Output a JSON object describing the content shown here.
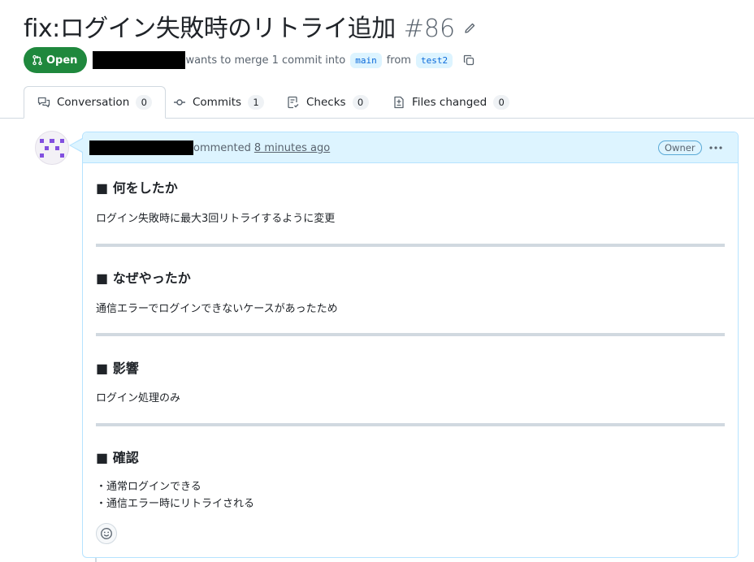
{
  "pr": {
    "title": "fix:ログイン失敗時のリトライ追加",
    "number": "#86",
    "state": "Open",
    "merge_text": "wants to merge 1 commit into",
    "base_branch": "main",
    "from_text": "from",
    "head_branch": "test2"
  },
  "tabs": [
    {
      "label": "Conversation",
      "count": "0",
      "icon": "comment-discussion-icon"
    },
    {
      "label": "Commits",
      "count": "1",
      "icon": "git-commit-icon"
    },
    {
      "label": "Checks",
      "count": "0",
      "icon": "checklist-icon"
    },
    {
      "label": "Files changed",
      "count": "0",
      "icon": "file-diff-icon"
    }
  ],
  "comment": {
    "action": "ommented",
    "time": "8 minutes ago",
    "role_badge": "Owner",
    "sections": [
      {
        "heading": "■ 何をしたか",
        "body": "ログイン失敗時に最大3回リトライするように変更"
      },
      {
        "heading": "■ なぜやったか",
        "body": "通信エラーでログインできないケースがあったため"
      },
      {
        "heading": "■ 影響",
        "body": "ログイン処理のみ"
      },
      {
        "heading": "■ 確認",
        "items": [
          "・通常ログインできる",
          "・通信エラー時にリトライされる"
        ]
      }
    ]
  },
  "colors": {
    "open_badge": "#1f883d",
    "accent": "#0969da",
    "comment_header": "#ddf4ff",
    "avatar_mark": "#8250df"
  }
}
